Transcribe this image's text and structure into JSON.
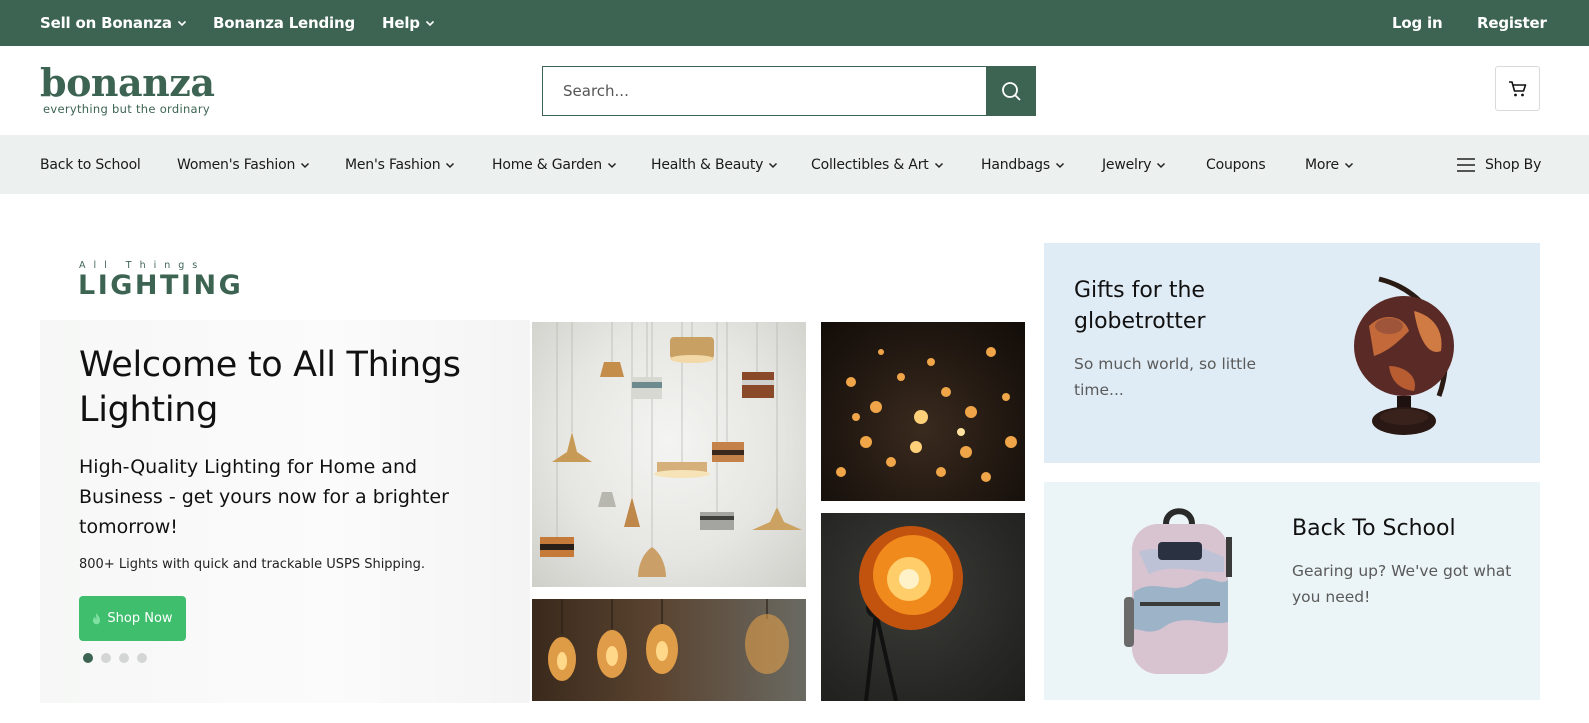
{
  "topbar": {
    "sell": "Sell on Bonanza",
    "lending": "Bonanza Lending",
    "help": "Help",
    "login": "Log in",
    "register": "Register"
  },
  "header": {
    "logo_text": "bonanza",
    "logo_tagline": "everything but the ordinary",
    "search_placeholder": "Search..."
  },
  "categories": {
    "back_to_school": "Back to School",
    "womens": "Women's Fashion",
    "mens": "Men's Fashion",
    "home": "Home & Garden",
    "health": "Health & Beauty",
    "collectibles": "Collectibles & Art",
    "handbags": "Handbags",
    "jewelry": "Jewelry",
    "coupons": "Coupons",
    "more": "More",
    "shop_by": "Shop By"
  },
  "hero": {
    "brand_small": "All Things",
    "brand_big": "LIGHTING",
    "title": "Welcome to All Things Lighting",
    "subtitle": "High-Quality Lighting for Home and Business - get yours now for a brighter tomorrow!",
    "note": "800+ Lights with quick and trackable USPS Shipping.",
    "cta": "Shop Now",
    "slides_total": 4,
    "active_slide": 1
  },
  "promos": {
    "globe": {
      "title": "Gifts for the globetrotter",
      "text": "So much world, so little time..."
    },
    "school": {
      "title": "Back To School",
      "text": "Gearing up? We've got what you need!"
    }
  },
  "colors": {
    "brand_green": "#3d6453",
    "cta_green": "#3fbf6e",
    "nav_bg": "#ecf1ef",
    "promo_blue": "#e0ecf5",
    "promo_teal": "#ebf4f6"
  }
}
